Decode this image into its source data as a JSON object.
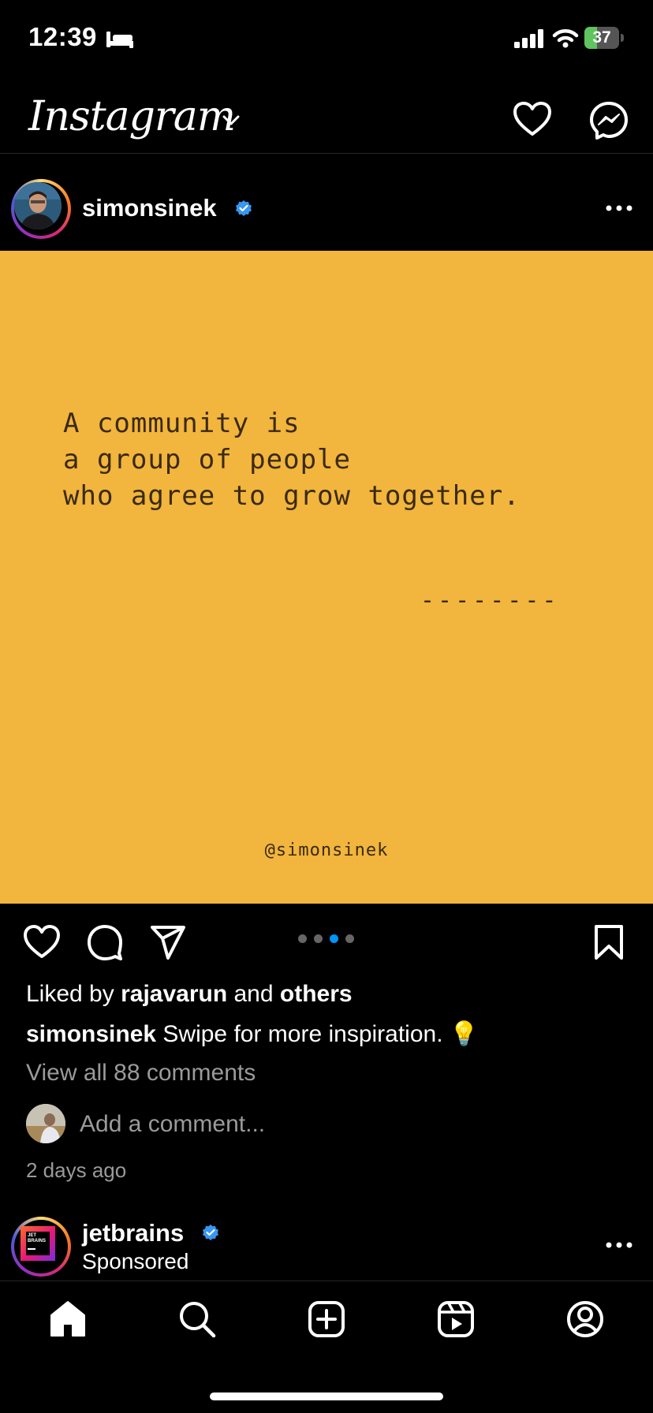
{
  "status_bar": {
    "time": "12:39",
    "battery": "37",
    "battery_level": 0.37
  },
  "header": {
    "app_title": "Instagram"
  },
  "post": {
    "username": "simonsinek",
    "quote_lines": [
      "A community is",
      "a group of people",
      "who agree to grow together."
    ],
    "dashes": "--------",
    "image_handle": "@simonsinek",
    "carousel": {
      "count": 4,
      "active": 2,
      "active_color": "#0095f6"
    },
    "likes": {
      "prefix": "Liked by ",
      "user": "rajavarun",
      "middle": " and ",
      "suffix": "others"
    },
    "caption": {
      "user": "simonsinek",
      "text": " Swipe for more inspiration. 💡"
    },
    "view_comments": "View all 88 comments",
    "add_comment_placeholder": "Add a comment...",
    "timestamp": "2 days ago",
    "image_bg": "#f2b53d"
  },
  "next_post": {
    "username": "jetbrains",
    "sponsored_label": "Sponsored",
    "logo_text": "JET BRAINS"
  },
  "nav": {
    "items": [
      "home-icon",
      "search-icon",
      "create-icon",
      "reels-icon",
      "profile-icon"
    ]
  },
  "colors": {
    "verified": "#3897f0",
    "background": "#000000"
  }
}
